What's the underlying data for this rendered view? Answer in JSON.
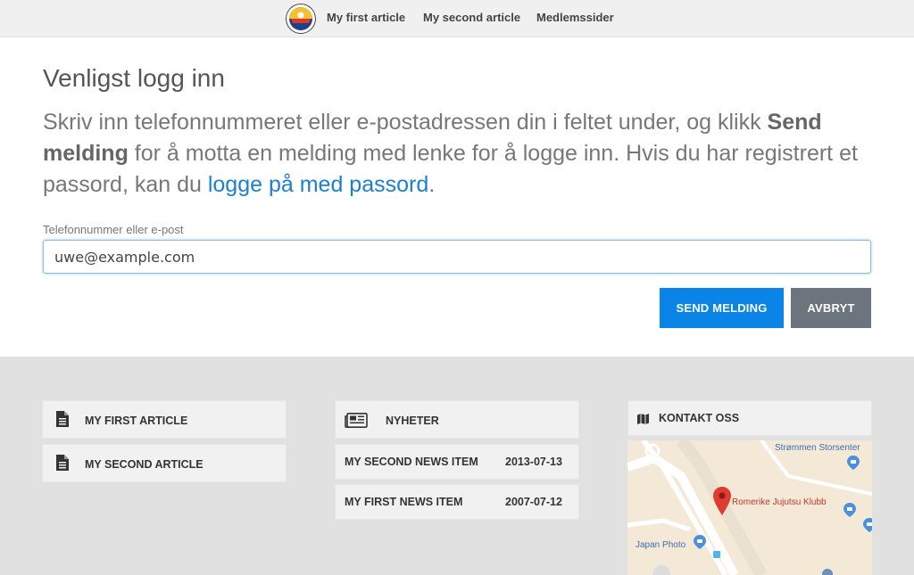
{
  "nav": {
    "links": [
      "My first article",
      "My second article",
      "Medlemssider"
    ]
  },
  "login": {
    "title": "Venligst logg inn",
    "intro_part1": "Skriv inn telefonnummeret eller e-postadressen din i feltet under, og klikk ",
    "intro_bold": "Send melding",
    "intro_part2": " for å motta en melding med lenke for å logge inn. Hvis du har registrert et passord, kan du ",
    "intro_link": "logge på med passord",
    "intro_end": ".",
    "field_label": "Telefonnummer eller e-post",
    "field_value": "uwe@example.com",
    "send_button": "SEND MELDING",
    "cancel_button": "AVBRYT"
  },
  "footer": {
    "articles": [
      {
        "label": "MY FIRST ARTICLE",
        "icon": "document-icon"
      },
      {
        "label": "MY SECOND ARTICLE",
        "icon": "document-icon"
      }
    ],
    "news": {
      "heading": "NYHETER",
      "icon": "newspaper-icon",
      "items": [
        {
          "title": "MY SECOND NEWS ITEM",
          "date": "2013-07-13"
        },
        {
          "title": "MY FIRST NEWS ITEM",
          "date": "2007-07-12"
        }
      ]
    },
    "contact": {
      "heading": "KONTAKT OSS",
      "icon": "map-icon",
      "map_labels": {
        "storsenter": "Strømmen Storsenter",
        "klubb": "Romerike Jujutsu Klubb",
        "japan": "Japan Photo"
      }
    }
  },
  "colors": {
    "primary": "#0b84e8",
    "secondary": "#6c747d",
    "link": "#1a7fd6",
    "pin": "#e03b30"
  }
}
